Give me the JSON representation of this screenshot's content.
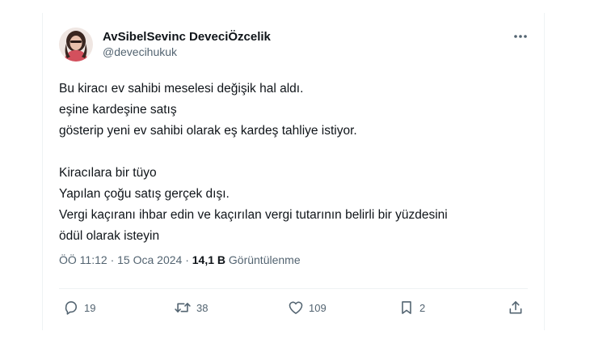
{
  "author": {
    "display_name": "AvSibelSevinc DeveciÖzcelik",
    "handle": "@devecihukuk"
  },
  "tweet": {
    "lines": [
      "Bu kiracı ev sahibi meselesi değişik hal aldı.",
      "eşine kardeşine satış",
      "gösterip yeni ev sahibi olarak eş kardeş tahliye istiyor.",
      "",
      "Kiracılara bir tüyo",
      "Yapılan çoğu satış gerçek dışı.",
      "Vergi kaçıranı ihbar edin ve kaçırılan vergi tutarının belirli bir yüzdesini",
      "ödül olarak isteyin"
    ]
  },
  "meta": {
    "time": "ÖÖ 11:12",
    "separator": "·",
    "date": "15 Oca 2024",
    "views_count": "14,1 B",
    "views_label": "Görüntülenme"
  },
  "actions": {
    "replies": "19",
    "retweets": "38",
    "likes": "109",
    "bookmarks": "2"
  },
  "icons": {
    "more": "more-horizontal-icon",
    "reply": "reply-icon",
    "retweet": "retweet-icon",
    "like": "heart-icon",
    "bookmark": "bookmark-icon",
    "share": "share-icon"
  },
  "colors": {
    "text": "#0f1419",
    "secondary": "#536471",
    "border": "#eff3f4"
  }
}
